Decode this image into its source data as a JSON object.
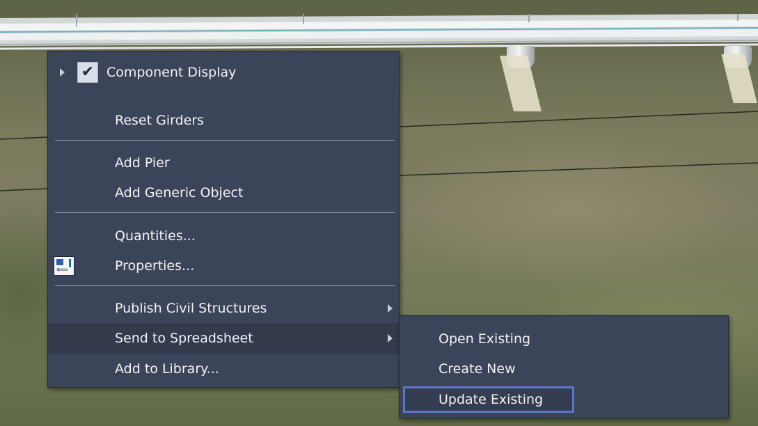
{
  "context_menu": {
    "items": [
      {
        "label": "Component Display",
        "checked": true,
        "has_submenu_left": true
      },
      {
        "label": "Reset Girders"
      },
      {
        "label": "Add Pier"
      },
      {
        "label": "Add Generic Object"
      },
      {
        "label": "Quantities..."
      },
      {
        "label": "Properties...",
        "icon": "properties-icon"
      },
      {
        "label": "Publish Civil Structures",
        "has_submenu": true
      },
      {
        "label": "Send to Spreadsheet",
        "has_submenu": true,
        "highlighted": true
      },
      {
        "label": "Add to Library..."
      }
    ]
  },
  "submenu": {
    "parent": "Send to Spreadsheet",
    "items": [
      {
        "label": "Open Existing"
      },
      {
        "label": "Create New"
      },
      {
        "label": "Update Existing",
        "focused": true
      }
    ]
  },
  "colors": {
    "menu_background": "#3b4458",
    "menu_highlight": "#323a4c",
    "menu_text": "#f1f3f7",
    "focus_outline": "#5a78c8"
  }
}
